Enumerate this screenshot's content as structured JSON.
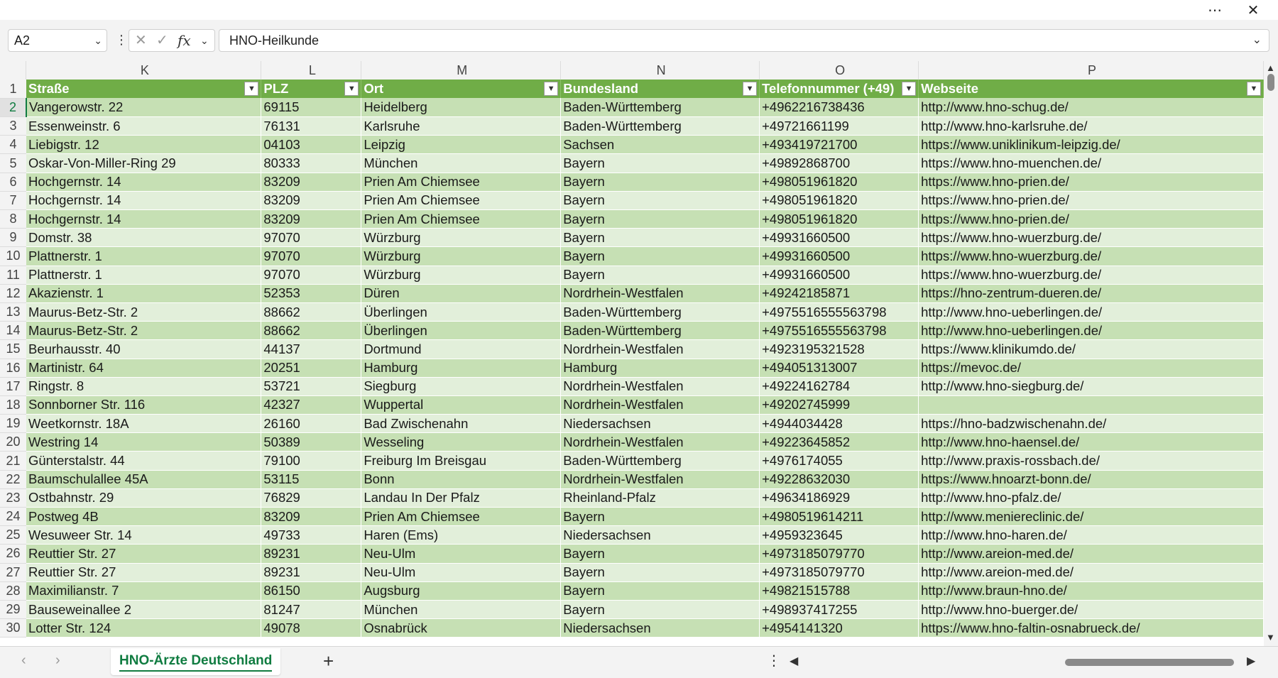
{
  "window": {
    "more_icon": "⋯",
    "close_icon": "✕"
  },
  "formula_bar": {
    "name_box": "A2",
    "fx_label": "fx",
    "value": "HNO-Heilkunde"
  },
  "column_letters": [
    "K",
    "L",
    "M",
    "N",
    "O",
    "P"
  ],
  "header_row_number": "1",
  "headers": [
    "Straße",
    "PLZ",
    "Ort",
    "Bundesland",
    "Telefonnummer (+49)",
    "Webseite"
  ],
  "rows": [
    {
      "n": "2",
      "c": [
        "Vangerowstr. 22",
        "69115",
        "Heidelberg",
        "Baden-Württemberg",
        "+4962216738436",
        "http://www.hno-schug.de/"
      ]
    },
    {
      "n": "3",
      "c": [
        "Essenweinstr. 6",
        "76131",
        "Karlsruhe",
        "Baden-Württemberg",
        "+49721661199",
        "http://www.hno-karlsruhe.de/"
      ]
    },
    {
      "n": "4",
      "c": [
        "Liebigstr. 12",
        "04103",
        "Leipzig",
        "Sachsen",
        "+493419721700",
        "https://www.uniklinikum-leipzig.de/"
      ]
    },
    {
      "n": "5",
      "c": [
        "Oskar-Von-Miller-Ring 29",
        "80333",
        "München",
        "Bayern",
        "+49892868700",
        "https://www.hno-muenchen.de/"
      ]
    },
    {
      "n": "6",
      "c": [
        "Hochgernstr. 14",
        "83209",
        "Prien Am Chiemsee",
        "Bayern",
        "+498051961820",
        "https://www.hno-prien.de/"
      ]
    },
    {
      "n": "7",
      "c": [
        "Hochgernstr. 14",
        "83209",
        "Prien Am Chiemsee",
        "Bayern",
        "+498051961820",
        "https://www.hno-prien.de/"
      ]
    },
    {
      "n": "8",
      "c": [
        "Hochgernstr. 14",
        "83209",
        "Prien Am Chiemsee",
        "Bayern",
        "+498051961820",
        "https://www.hno-prien.de/"
      ]
    },
    {
      "n": "9",
      "c": [
        "Domstr. 38",
        "97070",
        "Würzburg",
        "Bayern",
        "+49931660500",
        "https://www.hno-wuerzburg.de/"
      ]
    },
    {
      "n": "10",
      "c": [
        "Plattnerstr. 1",
        "97070",
        "Würzburg",
        "Bayern",
        "+49931660500",
        "https://www.hno-wuerzburg.de/"
      ]
    },
    {
      "n": "11",
      "c": [
        "Plattnerstr. 1",
        "97070",
        "Würzburg",
        "Bayern",
        "+49931660500",
        "https://www.hno-wuerzburg.de/"
      ]
    },
    {
      "n": "12",
      "c": [
        "Akazienstr. 1",
        "52353",
        "Düren",
        "Nordrhein-Westfalen",
        "+49242185871",
        "https://hno-zentrum-dueren.de/"
      ]
    },
    {
      "n": "13",
      "c": [
        "Maurus-Betz-Str. 2",
        "88662",
        "Überlingen",
        "Baden-Württemberg",
        "+4975516555563798",
        "http://www.hno-ueberlingen.de/"
      ]
    },
    {
      "n": "14",
      "c": [
        "Maurus-Betz-Str. 2",
        "88662",
        "Überlingen",
        "Baden-Württemberg",
        "+4975516555563798",
        "http://www.hno-ueberlingen.de/"
      ]
    },
    {
      "n": "15",
      "c": [
        "Beurhausstr. 40",
        "44137",
        "Dortmund",
        "Nordrhein-Westfalen",
        "+4923195321528",
        "https://www.klinikumdo.de/"
      ]
    },
    {
      "n": "16",
      "c": [
        "Martinistr. 64",
        "20251",
        "Hamburg",
        "Hamburg",
        "+494051313007",
        "https://mevoc.de/"
      ]
    },
    {
      "n": "17",
      "c": [
        "Ringstr. 8",
        "53721",
        "Siegburg",
        "Nordrhein-Westfalen",
        "+49224162784",
        "http://www.hno-siegburg.de/"
      ]
    },
    {
      "n": "18",
      "c": [
        "Sonnborner Str. 116",
        "42327",
        "Wuppertal",
        "Nordrhein-Westfalen",
        "+49202745999",
        ""
      ]
    },
    {
      "n": "19",
      "c": [
        "Weetkornstr. 18A",
        "26160",
        "Bad Zwischenahn",
        "Niedersachsen",
        "+4944034428",
        "https://hno-badzwischenahn.de/"
      ]
    },
    {
      "n": "20",
      "c": [
        "Westring 14",
        "50389",
        "Wesseling",
        "Nordrhein-Westfalen",
        "+49223645852",
        "http://www.hno-haensel.de/"
      ]
    },
    {
      "n": "21",
      "c": [
        "Günterstalstr. 44",
        "79100",
        "Freiburg Im Breisgau",
        "Baden-Württemberg",
        "+4976174055",
        "http://www.praxis-rossbach.de/"
      ]
    },
    {
      "n": "22",
      "c": [
        "Baumschulallee 45A",
        "53115",
        "Bonn",
        "Nordrhein-Westfalen",
        "+49228632030",
        "https://www.hnoarzt-bonn.de/"
      ]
    },
    {
      "n": "23",
      "c": [
        "Ostbahnstr. 29",
        "76829",
        "Landau In Der Pfalz",
        "Rheinland-Pfalz",
        "+49634186929",
        "http://www.hno-pfalz.de/"
      ]
    },
    {
      "n": "24",
      "c": [
        "Postweg 4B",
        "83209",
        "Prien Am Chiemsee",
        "Bayern",
        "+4980519614211",
        "http://www.meniereclinic.de/"
      ]
    },
    {
      "n": "25",
      "c": [
        "Wesuweer Str. 14",
        "49733",
        "Haren (Ems)",
        "Niedersachsen",
        "+4959323645",
        "http://www.hno-haren.de/"
      ]
    },
    {
      "n": "26",
      "c": [
        "Reuttier Str. 27",
        "89231",
        "Neu-Ulm",
        "Bayern",
        "+4973185079770",
        "http://www.areion-med.de/"
      ]
    },
    {
      "n": "27",
      "c": [
        "Reuttier Str. 27",
        "89231",
        "Neu-Ulm",
        "Bayern",
        "+4973185079770",
        "http://www.areion-med.de/"
      ]
    },
    {
      "n": "28",
      "c": [
        "Maximilianstr. 7",
        "86150",
        "Augsburg",
        "Bayern",
        "+49821515788",
        "http://www.braun-hno.de/"
      ]
    },
    {
      "n": "29",
      "c": [
        "Bauseweinallee 2",
        "81247",
        "München",
        "Bayern",
        "+498937417255",
        "http://www.hno-buerger.de/"
      ]
    },
    {
      "n": "30",
      "c": [
        "Lotter Str. 124",
        "49078",
        "Osnabrück",
        "Niedersachsen",
        "+4954141320",
        "https://www.hno-faltin-osnabrueck.de/"
      ]
    }
  ],
  "sheet_tab": "HNO-Ärzte Deutschland",
  "add_sheet": "+",
  "colors": {
    "header_green": "#70ad47",
    "band_dark": "#c6e0b4",
    "band_light": "#e2efda",
    "accent": "#107c41"
  }
}
